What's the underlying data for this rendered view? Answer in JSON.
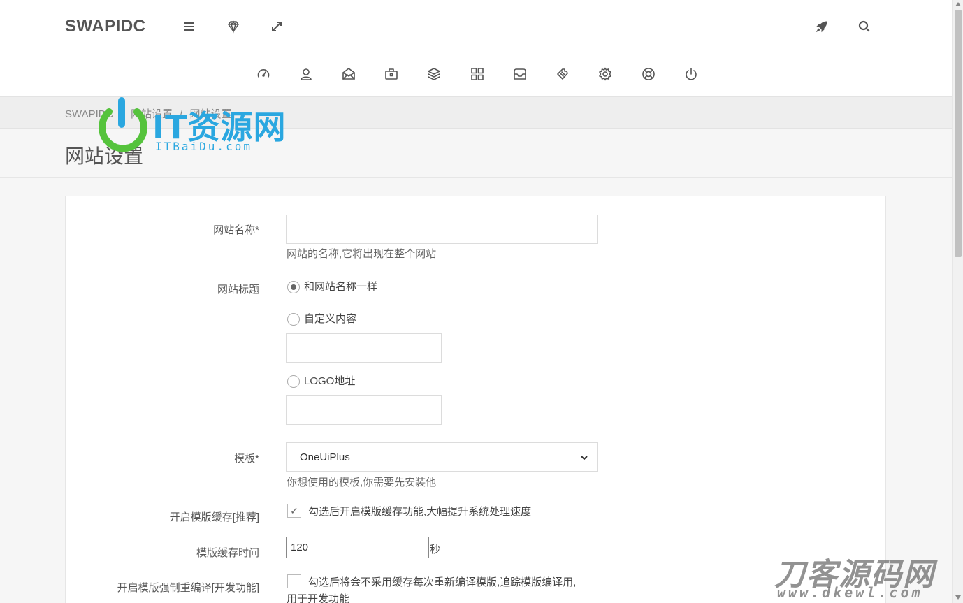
{
  "header": {
    "brand": "SWAPIDC",
    "icons": [
      "menu-icon",
      "gem-icon",
      "expand-icon",
      "rocket-icon",
      "search-icon"
    ]
  },
  "nav": {
    "icons": [
      "dashboard-icon",
      "user-icon",
      "mail-open-icon",
      "briefcase-icon",
      "layers-icon",
      "grid-icon",
      "inbox-icon",
      "wrench-icon",
      "gear-icon",
      "lifebuoy-icon",
      "power-icon"
    ]
  },
  "breadcrumb": {
    "items": [
      "SWAPIDC",
      "/",
      "网站设置",
      "/",
      "网站设置"
    ]
  },
  "page": {
    "title": "网站设置"
  },
  "watermarks": {
    "top_text": "IT资源网",
    "top_sub": "ITBaiDu.com",
    "bottom_text": "刀客源码网",
    "bottom_sub": "www.dkewl.com"
  },
  "form": {
    "site_name": {
      "label": "网站名称*",
      "value": "",
      "help": "网站的名称,它将出现在整个网站"
    },
    "site_title": {
      "label": "网站标题",
      "options": [
        {
          "label": "和网站名称一样",
          "checked": true
        },
        {
          "label": "自定义内容",
          "checked": false
        },
        {
          "label": "LOGO地址",
          "checked": false
        }
      ],
      "custom_value": "",
      "logo_value": ""
    },
    "template": {
      "label": "模板*",
      "selected": "OneUiPlus",
      "help": "你想使用的模板,你需要先安装他"
    },
    "template_cache": {
      "label": "开启模版缓存[推荐]",
      "checked": true,
      "text": "勾选后开启模版缓存功能,大幅提升系统处理速度"
    },
    "cache_time": {
      "label": "模版缓存时间",
      "value": "120",
      "unit": "秒"
    },
    "force_recompile": {
      "label": "开启模版强制重编译[开发功能]",
      "checked": false,
      "text_line1": "勾选后将会不采用缓存每次重新编译模版,追踪模版编译用,",
      "text_line2": "用于开发功能"
    }
  }
}
